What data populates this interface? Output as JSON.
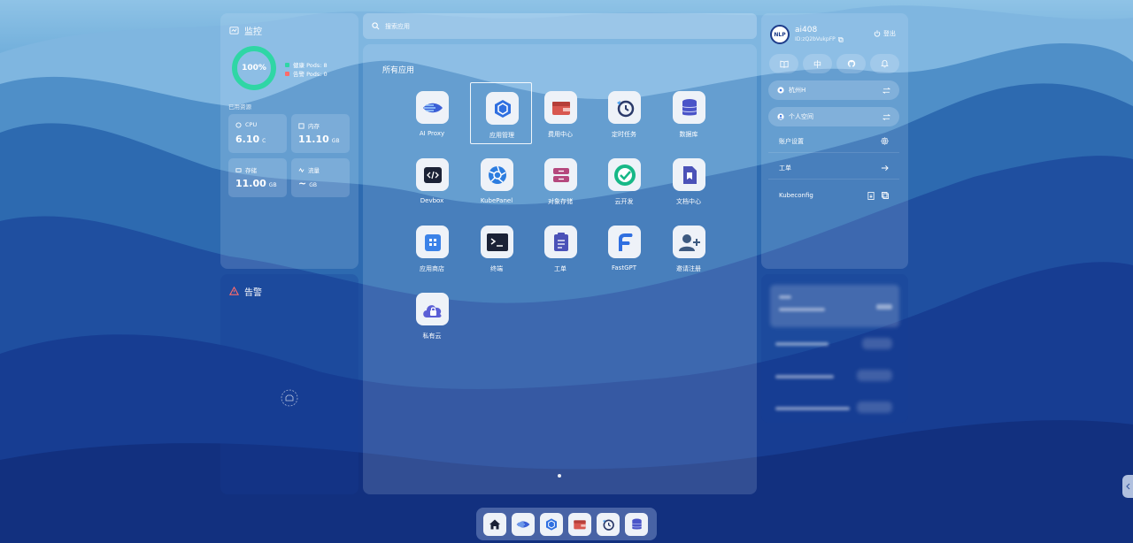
{
  "monitor": {
    "title": "监控",
    "health_percent": "100%",
    "health_fraction": 1.0,
    "healthy_pods": "健康 Pods: 8",
    "alert_pods": "告警 Pods: 0",
    "resources_title": "已用资源",
    "colors": {
      "ring": "#2fd6a5",
      "healthy": "#2fd6a5",
      "alert": "#ff6b6b"
    },
    "cpu": {
      "label": "CPU",
      "value": "6.10",
      "unit": "C"
    },
    "memory": {
      "label": "内存",
      "value": "11.10",
      "unit": "GB"
    },
    "storage": {
      "label": "存储",
      "value": "11.00",
      "unit": "GB"
    },
    "traffic": {
      "label": "流量",
      "value": "~",
      "unit": "GB"
    }
  },
  "alert": {
    "title": "告警"
  },
  "search": {
    "placeholder": "搜索应用"
  },
  "apps": {
    "title": "所有应用",
    "items": [
      {
        "label": "AI Proxy",
        "icon": "ai-proxy-icon"
      },
      {
        "label": "应用管理",
        "icon": "app-manage-icon"
      },
      {
        "label": "费用中心",
        "icon": "wallet-icon"
      },
      {
        "label": "定时任务",
        "icon": "cron-icon"
      },
      {
        "label": "数据库",
        "icon": "database-icon"
      },
      {
        "label": "Devbox",
        "icon": "devbox-icon"
      },
      {
        "label": "KubePanel",
        "icon": "kubepanel-icon"
      },
      {
        "label": "对象存储",
        "icon": "object-storage-icon"
      },
      {
        "label": "云开发",
        "icon": "cloud-dev-icon"
      },
      {
        "label": "文档中心",
        "icon": "docs-icon"
      },
      {
        "label": "应用商店",
        "icon": "app-store-icon"
      },
      {
        "label": "终端",
        "icon": "terminal-icon"
      },
      {
        "label": "工单",
        "icon": "workorder-icon"
      },
      {
        "label": "FastGPT",
        "icon": "fastgpt-icon"
      },
      {
        "label": "邀请注册",
        "icon": "invite-icon"
      },
      {
        "label": "私有云",
        "icon": "private-cloud-icon"
      }
    ],
    "selected_index": 1
  },
  "account": {
    "avatar_text": "NLP",
    "username": "ai408",
    "user_id": "ID:zQ2bVukpFP",
    "logout_label": "登出",
    "lang_label": "中",
    "region": "杭州H",
    "workspace": "个人空间",
    "menu": [
      {
        "label": "账户设置"
      },
      {
        "label": "工单"
      },
      {
        "label": "Kubeconfig"
      }
    ]
  }
}
